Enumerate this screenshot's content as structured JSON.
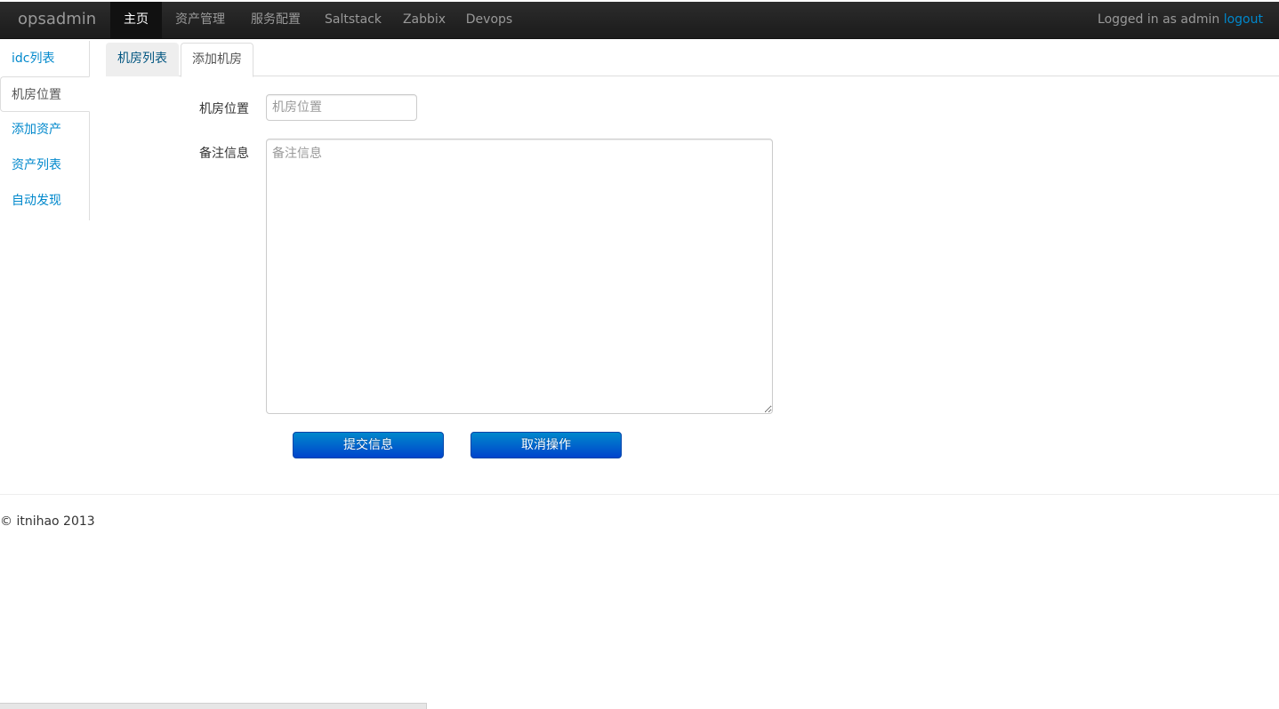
{
  "navbar": {
    "brand": "opsadmin",
    "items": [
      {
        "label": "主页",
        "active": true
      },
      {
        "label": "资产管理",
        "active": false
      },
      {
        "label": "服务配置",
        "active": false
      },
      {
        "label": "Saltstack",
        "active": false
      },
      {
        "label": "Zabbix",
        "active": false
      },
      {
        "label": "Devops",
        "active": false
      }
    ],
    "user_text": "Logged in as admin",
    "logout_label": "logout"
  },
  "sidebar": {
    "items": [
      {
        "label": "idc列表",
        "active": false
      },
      {
        "label": "机房位置",
        "active": true
      },
      {
        "label": "添加资产",
        "active": false
      },
      {
        "label": "资产列表",
        "active": false
      },
      {
        "label": "自动发现",
        "active": false
      }
    ]
  },
  "tabs": [
    {
      "label": "机房列表",
      "active": false
    },
    {
      "label": "添加机房",
      "active": true
    }
  ],
  "form": {
    "location_label": "机房位置",
    "location_placeholder": "机房位置",
    "location_value": "",
    "notes_label": "备注信息",
    "notes_placeholder": "备注信息",
    "notes_value": "",
    "submit_label": "提交信息",
    "cancel_label": "取消操作"
  },
  "footer": {
    "text": "© itnihao 2013"
  },
  "colors": {
    "navbar_bg": "#1b1b1b",
    "link": "#0088cc",
    "button_primary": "#0055cc"
  }
}
